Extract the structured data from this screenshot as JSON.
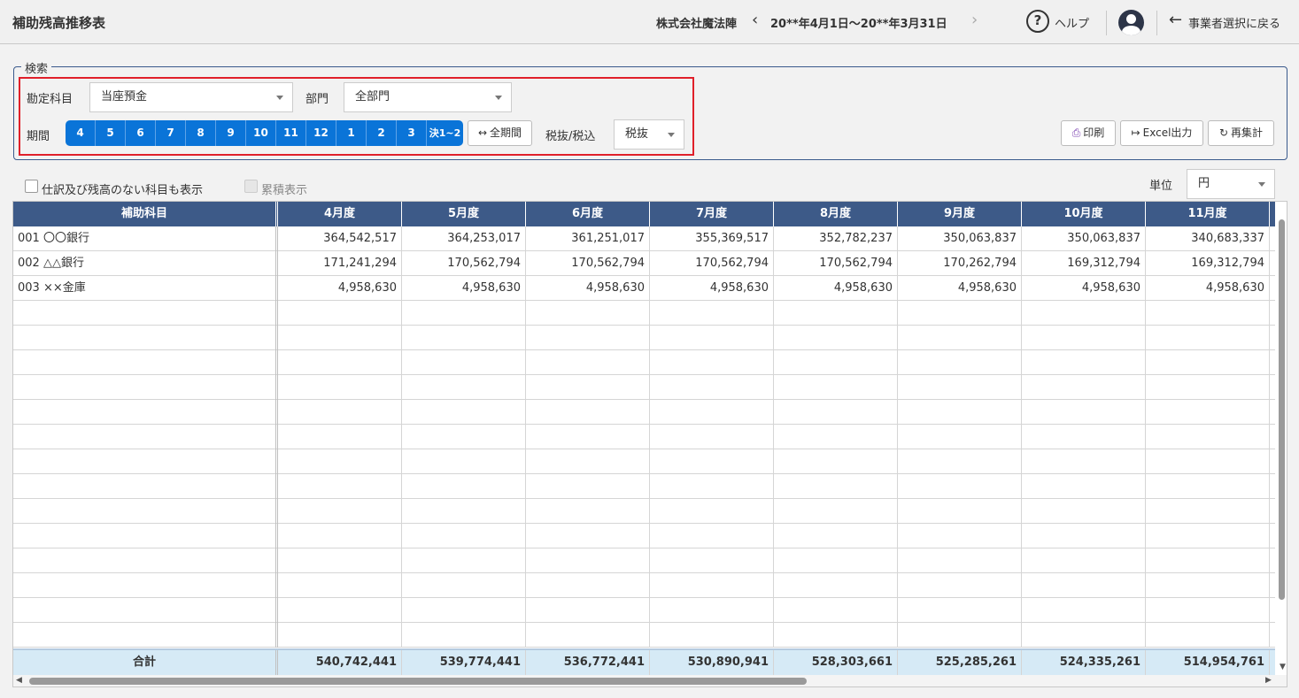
{
  "header": {
    "title": "補助残高推移表",
    "company": "株式会社魔法陣",
    "period": "20**年4月1日～20**年3月31日",
    "help_label": "ヘルプ",
    "back_label": "事業者選択に戻る"
  },
  "search": {
    "legend": "検索",
    "account_label": "勘定科目",
    "account_value": "当座預金",
    "dept_label": "部門",
    "dept_value": "全部門",
    "period_label": "期間",
    "months": [
      "4",
      "5",
      "6",
      "7",
      "8",
      "9",
      "10",
      "11",
      "12",
      "1",
      "2",
      "3",
      "決1~2"
    ],
    "all_period_label": "全期間",
    "tax_label": "税抜/税込",
    "tax_value": "税抜",
    "print_label": "印刷",
    "excel_label": "Excel出力",
    "recalc_label": "再集計"
  },
  "options": {
    "show_empty_label": "仕訳及び残高のない科目も表示",
    "cumulative_label": "累積表示",
    "unit_label": "単位",
    "unit_value": "円"
  },
  "table": {
    "columns": [
      "補助科目",
      "4月度",
      "5月度",
      "6月度",
      "7月度",
      "8月度",
      "9月度",
      "10月度",
      "11月度"
    ],
    "rows": [
      [
        "001  〇〇銀行",
        "364,542,517",
        "364,253,017",
        "361,251,017",
        "355,369,517",
        "352,782,237",
        "350,063,837",
        "350,063,837",
        "340,683,337"
      ],
      [
        "002  △△銀行",
        "171,241,294",
        "170,562,794",
        "170,562,794",
        "170,562,794",
        "170,562,794",
        "170,262,794",
        "169,312,794",
        "169,312,794"
      ],
      [
        "003  ××金庫",
        "4,958,630",
        "4,958,630",
        "4,958,630",
        "4,958,630",
        "4,958,630",
        "4,958,630",
        "4,958,630",
        "4,958,630"
      ]
    ],
    "total": [
      "合計",
      "540,742,441",
      "539,774,441",
      "536,772,441",
      "530,890,941",
      "528,303,661",
      "525,285,261",
      "524,335,261",
      "514,954,761"
    ]
  }
}
